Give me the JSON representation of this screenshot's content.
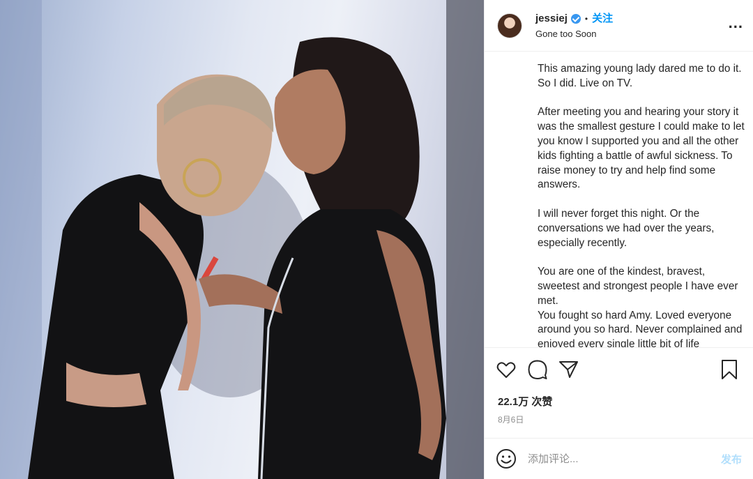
{
  "header": {
    "username": "jessiej",
    "separator": "•",
    "follow_label": "关注",
    "location": "Gone too Soon",
    "more_label": "..."
  },
  "caption": {
    "text": "This amazing young lady dared me to do it. So I did. Live on TV.\n\nAfter meeting you and hearing your story it was the smallest gesture I could make to let you know I supported you and all the other kids fighting a battle of awful sickness. To raise money to try and help find some answers.\n\nI will never forget this night. Or the conversations we had over the years, especially recently.\n\nYou are one of the kindest, bravest, sweetest and strongest people I have ever met.\nYou fought so hard Amy. Loved everyone around you so hard. Never complained and enjoyed every single little bit of life"
  },
  "actions": {
    "icons": [
      "heart-icon",
      "comment-icon",
      "share-icon",
      "bookmark-icon"
    ]
  },
  "stats": {
    "likes": "22.1万 次赞",
    "date": "8月6日"
  },
  "comment": {
    "placeholder": "添加评论...",
    "post_label": "发布"
  },
  "colors": {
    "link_blue": "#0095f6",
    "post_disabled": "#b2dffc",
    "verified_blue": "#3897f0",
    "muted": "#8e8e8e"
  }
}
